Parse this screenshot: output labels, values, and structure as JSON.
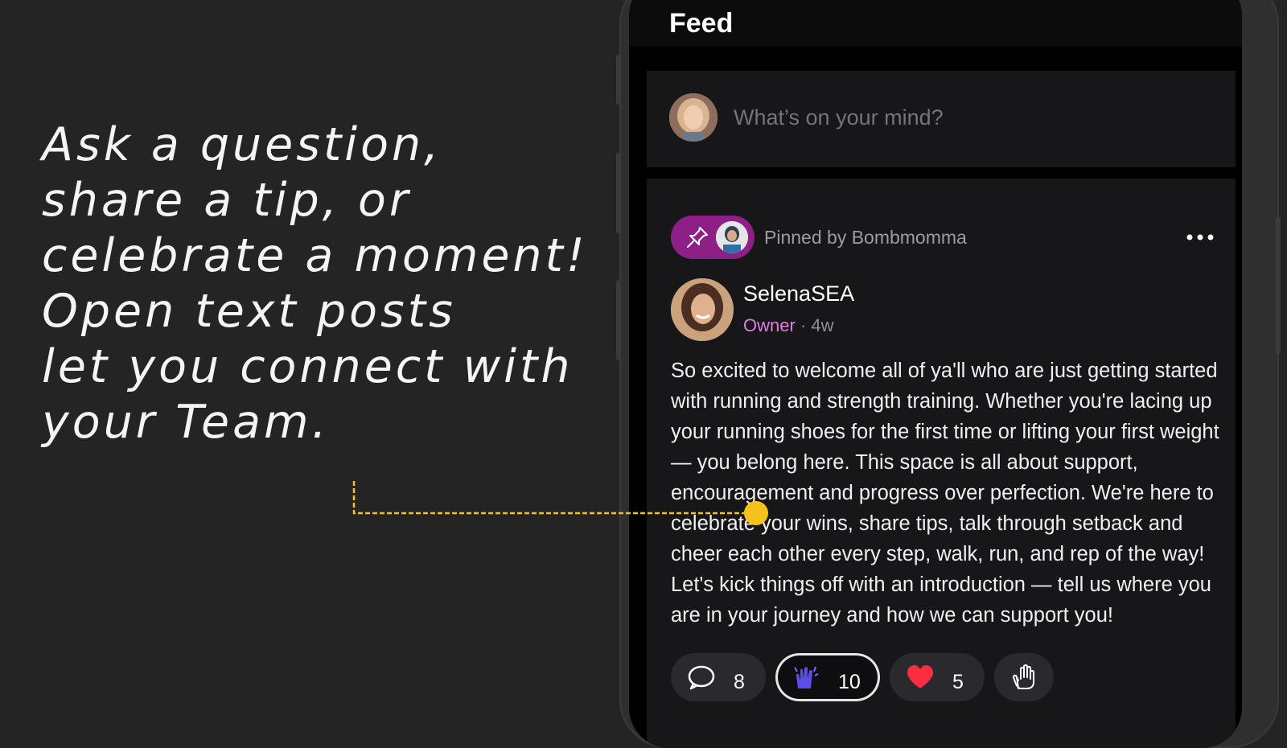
{
  "promo": {
    "lines": [
      "Ask a question,",
      "share a tip, or",
      "celebrate a moment!",
      "Open text posts",
      "let you connect with",
      "your Team."
    ]
  },
  "feed": {
    "title": "Feed",
    "composer_placeholder": "What’s on your mind?"
  },
  "post": {
    "pinned_label": "Pinned by Bombmomma",
    "author_name": "SelenaSEA",
    "author_role": "Owner",
    "meta_separator": " · ",
    "time_ago": "4w",
    "body": "So excited to welcome all of ya'll who are just getting started with running and strength training. Whether you're lacing up your running shoes for the first time or lifting your first weight — you belong here. This space is all about support, encouragement and progress over perfection. We're here to celebrate your wins, share tips, talk through setback and cheer each other every step, walk, run, and rep of the way! Let's kick things off with an introduction — tell us where you are in your journey and how we can support you!",
    "reactions": [
      {
        "icon": "comment-icon",
        "count": "8"
      },
      {
        "icon": "hands-celebrate-icon",
        "count": "10",
        "active": true
      },
      {
        "icon": "heart-icon",
        "count": "5"
      },
      {
        "icon": "raised-hand-icon",
        "count": ""
      }
    ]
  },
  "colors": {
    "background": "#242424",
    "accent_pink": "#8e1f86",
    "owner_role": "#e27ce2",
    "pointer": "#f5c21b"
  }
}
